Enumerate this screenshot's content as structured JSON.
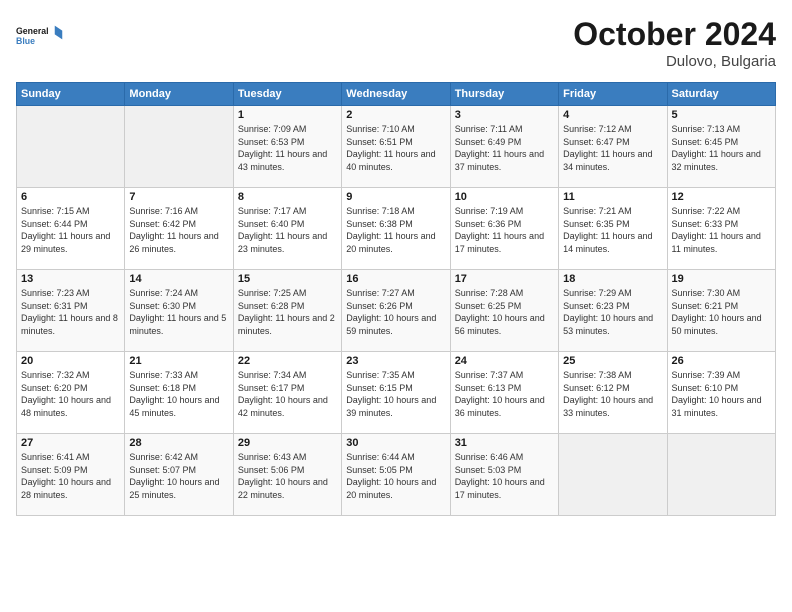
{
  "logo": {
    "line1": "General",
    "line2": "Blue"
  },
  "title": "October 2024",
  "location": "Dulovo, Bulgaria",
  "days_header": [
    "Sunday",
    "Monday",
    "Tuesday",
    "Wednesday",
    "Thursday",
    "Friday",
    "Saturday"
  ],
  "weeks": [
    [
      {
        "day": "",
        "sunrise": "",
        "sunset": "",
        "daylight": ""
      },
      {
        "day": "",
        "sunrise": "",
        "sunset": "",
        "daylight": ""
      },
      {
        "day": "1",
        "sunrise": "Sunrise: 7:09 AM",
        "sunset": "Sunset: 6:53 PM",
        "daylight": "Daylight: 11 hours and 43 minutes."
      },
      {
        "day": "2",
        "sunrise": "Sunrise: 7:10 AM",
        "sunset": "Sunset: 6:51 PM",
        "daylight": "Daylight: 11 hours and 40 minutes."
      },
      {
        "day": "3",
        "sunrise": "Sunrise: 7:11 AM",
        "sunset": "Sunset: 6:49 PM",
        "daylight": "Daylight: 11 hours and 37 minutes."
      },
      {
        "day": "4",
        "sunrise": "Sunrise: 7:12 AM",
        "sunset": "Sunset: 6:47 PM",
        "daylight": "Daylight: 11 hours and 34 minutes."
      },
      {
        "day": "5",
        "sunrise": "Sunrise: 7:13 AM",
        "sunset": "Sunset: 6:45 PM",
        "daylight": "Daylight: 11 hours and 32 minutes."
      }
    ],
    [
      {
        "day": "6",
        "sunrise": "Sunrise: 7:15 AM",
        "sunset": "Sunset: 6:44 PM",
        "daylight": "Daylight: 11 hours and 29 minutes."
      },
      {
        "day": "7",
        "sunrise": "Sunrise: 7:16 AM",
        "sunset": "Sunset: 6:42 PM",
        "daylight": "Daylight: 11 hours and 26 minutes."
      },
      {
        "day": "8",
        "sunrise": "Sunrise: 7:17 AM",
        "sunset": "Sunset: 6:40 PM",
        "daylight": "Daylight: 11 hours and 23 minutes."
      },
      {
        "day": "9",
        "sunrise": "Sunrise: 7:18 AM",
        "sunset": "Sunset: 6:38 PM",
        "daylight": "Daylight: 11 hours and 20 minutes."
      },
      {
        "day": "10",
        "sunrise": "Sunrise: 7:19 AM",
        "sunset": "Sunset: 6:36 PM",
        "daylight": "Daylight: 11 hours and 17 minutes."
      },
      {
        "day": "11",
        "sunrise": "Sunrise: 7:21 AM",
        "sunset": "Sunset: 6:35 PM",
        "daylight": "Daylight: 11 hours and 14 minutes."
      },
      {
        "day": "12",
        "sunrise": "Sunrise: 7:22 AM",
        "sunset": "Sunset: 6:33 PM",
        "daylight": "Daylight: 11 hours and 11 minutes."
      }
    ],
    [
      {
        "day": "13",
        "sunrise": "Sunrise: 7:23 AM",
        "sunset": "Sunset: 6:31 PM",
        "daylight": "Daylight: 11 hours and 8 minutes."
      },
      {
        "day": "14",
        "sunrise": "Sunrise: 7:24 AM",
        "sunset": "Sunset: 6:30 PM",
        "daylight": "Daylight: 11 hours and 5 minutes."
      },
      {
        "day": "15",
        "sunrise": "Sunrise: 7:25 AM",
        "sunset": "Sunset: 6:28 PM",
        "daylight": "Daylight: 11 hours and 2 minutes."
      },
      {
        "day": "16",
        "sunrise": "Sunrise: 7:27 AM",
        "sunset": "Sunset: 6:26 PM",
        "daylight": "Daylight: 10 hours and 59 minutes."
      },
      {
        "day": "17",
        "sunrise": "Sunrise: 7:28 AM",
        "sunset": "Sunset: 6:25 PM",
        "daylight": "Daylight: 10 hours and 56 minutes."
      },
      {
        "day": "18",
        "sunrise": "Sunrise: 7:29 AM",
        "sunset": "Sunset: 6:23 PM",
        "daylight": "Daylight: 10 hours and 53 minutes."
      },
      {
        "day": "19",
        "sunrise": "Sunrise: 7:30 AM",
        "sunset": "Sunset: 6:21 PM",
        "daylight": "Daylight: 10 hours and 50 minutes."
      }
    ],
    [
      {
        "day": "20",
        "sunrise": "Sunrise: 7:32 AM",
        "sunset": "Sunset: 6:20 PM",
        "daylight": "Daylight: 10 hours and 48 minutes."
      },
      {
        "day": "21",
        "sunrise": "Sunrise: 7:33 AM",
        "sunset": "Sunset: 6:18 PM",
        "daylight": "Daylight: 10 hours and 45 minutes."
      },
      {
        "day": "22",
        "sunrise": "Sunrise: 7:34 AM",
        "sunset": "Sunset: 6:17 PM",
        "daylight": "Daylight: 10 hours and 42 minutes."
      },
      {
        "day": "23",
        "sunrise": "Sunrise: 7:35 AM",
        "sunset": "Sunset: 6:15 PM",
        "daylight": "Daylight: 10 hours and 39 minutes."
      },
      {
        "day": "24",
        "sunrise": "Sunrise: 7:37 AM",
        "sunset": "Sunset: 6:13 PM",
        "daylight": "Daylight: 10 hours and 36 minutes."
      },
      {
        "day": "25",
        "sunrise": "Sunrise: 7:38 AM",
        "sunset": "Sunset: 6:12 PM",
        "daylight": "Daylight: 10 hours and 33 minutes."
      },
      {
        "day": "26",
        "sunrise": "Sunrise: 7:39 AM",
        "sunset": "Sunset: 6:10 PM",
        "daylight": "Daylight: 10 hours and 31 minutes."
      }
    ],
    [
      {
        "day": "27",
        "sunrise": "Sunrise: 6:41 AM",
        "sunset": "Sunset: 5:09 PM",
        "daylight": "Daylight: 10 hours and 28 minutes."
      },
      {
        "day": "28",
        "sunrise": "Sunrise: 6:42 AM",
        "sunset": "Sunset: 5:07 PM",
        "daylight": "Daylight: 10 hours and 25 minutes."
      },
      {
        "day": "29",
        "sunrise": "Sunrise: 6:43 AM",
        "sunset": "Sunset: 5:06 PM",
        "daylight": "Daylight: 10 hours and 22 minutes."
      },
      {
        "day": "30",
        "sunrise": "Sunrise: 6:44 AM",
        "sunset": "Sunset: 5:05 PM",
        "daylight": "Daylight: 10 hours and 20 minutes."
      },
      {
        "day": "31",
        "sunrise": "Sunrise: 6:46 AM",
        "sunset": "Sunset: 5:03 PM",
        "daylight": "Daylight: 10 hours and 17 minutes."
      },
      {
        "day": "",
        "sunrise": "",
        "sunset": "",
        "daylight": ""
      },
      {
        "day": "",
        "sunrise": "",
        "sunset": "",
        "daylight": ""
      }
    ]
  ]
}
